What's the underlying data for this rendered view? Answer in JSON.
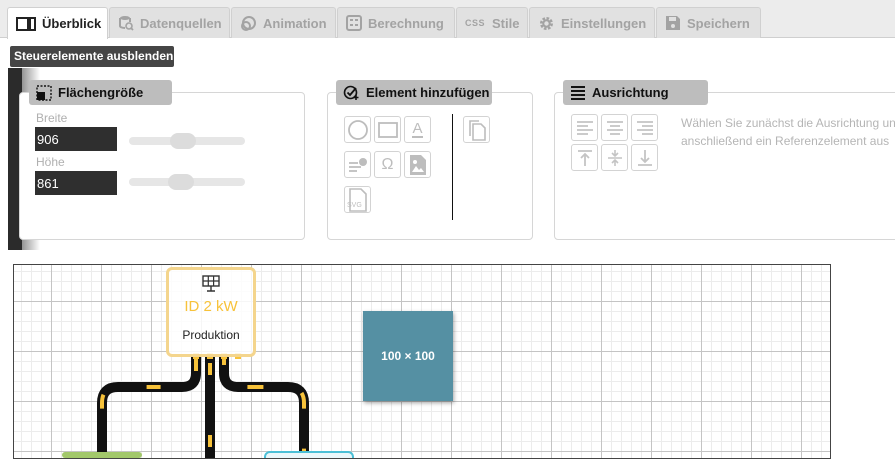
{
  "tabs": [
    {
      "label": "Überblick",
      "icon": "overview-icon",
      "active": true
    },
    {
      "label": "Datenquellen",
      "icon": "datasource-icon",
      "active": false
    },
    {
      "label": "Animation",
      "icon": "animation-icon",
      "active": false
    },
    {
      "label": "Berechnung",
      "icon": "calculator-icon",
      "active": false
    },
    {
      "label": "Stile",
      "icon": "css-icon",
      "icon_text": "CSS",
      "active": false
    },
    {
      "label": "Einstellungen",
      "icon": "gear-icon",
      "active": false
    },
    {
      "label": "Speichern",
      "icon": "save-icon",
      "active": false
    }
  ],
  "controls_toggle": "Steuerelemente ausblenden",
  "flaechen": {
    "title": "Flächengröße",
    "width_label": "Breite",
    "width_value": "906",
    "height_label": "Höhe",
    "height_value": "861"
  },
  "element": {
    "title": "Element hinzufügen",
    "tools": [
      {
        "name": "circle-icon"
      },
      {
        "name": "rectangle-icon"
      },
      {
        "name": "text-icon",
        "text": "A"
      },
      {
        "name": "list-check-icon"
      },
      {
        "name": "omega-icon",
        "text": "Ω"
      },
      {
        "name": "image-icon"
      },
      {
        "name": "svg-file-icon",
        "text": "SVG"
      },
      {
        "name": "duplicate-icon"
      }
    ]
  },
  "ausrichtung": {
    "title": "Ausrichtung",
    "hint_line1": "Wählen Sie zunächst die Ausrichtung und",
    "hint_line2": "anschließend ein Referenzelement aus"
  },
  "canvas": {
    "node_value": "ID 2 kW",
    "node_label": "Produktion",
    "box_label": "100 × 100"
  },
  "colors": {
    "accent_yellow": "#f7c23a",
    "box_blue": "#5590a3",
    "dark_input": "#2f2f2f"
  }
}
